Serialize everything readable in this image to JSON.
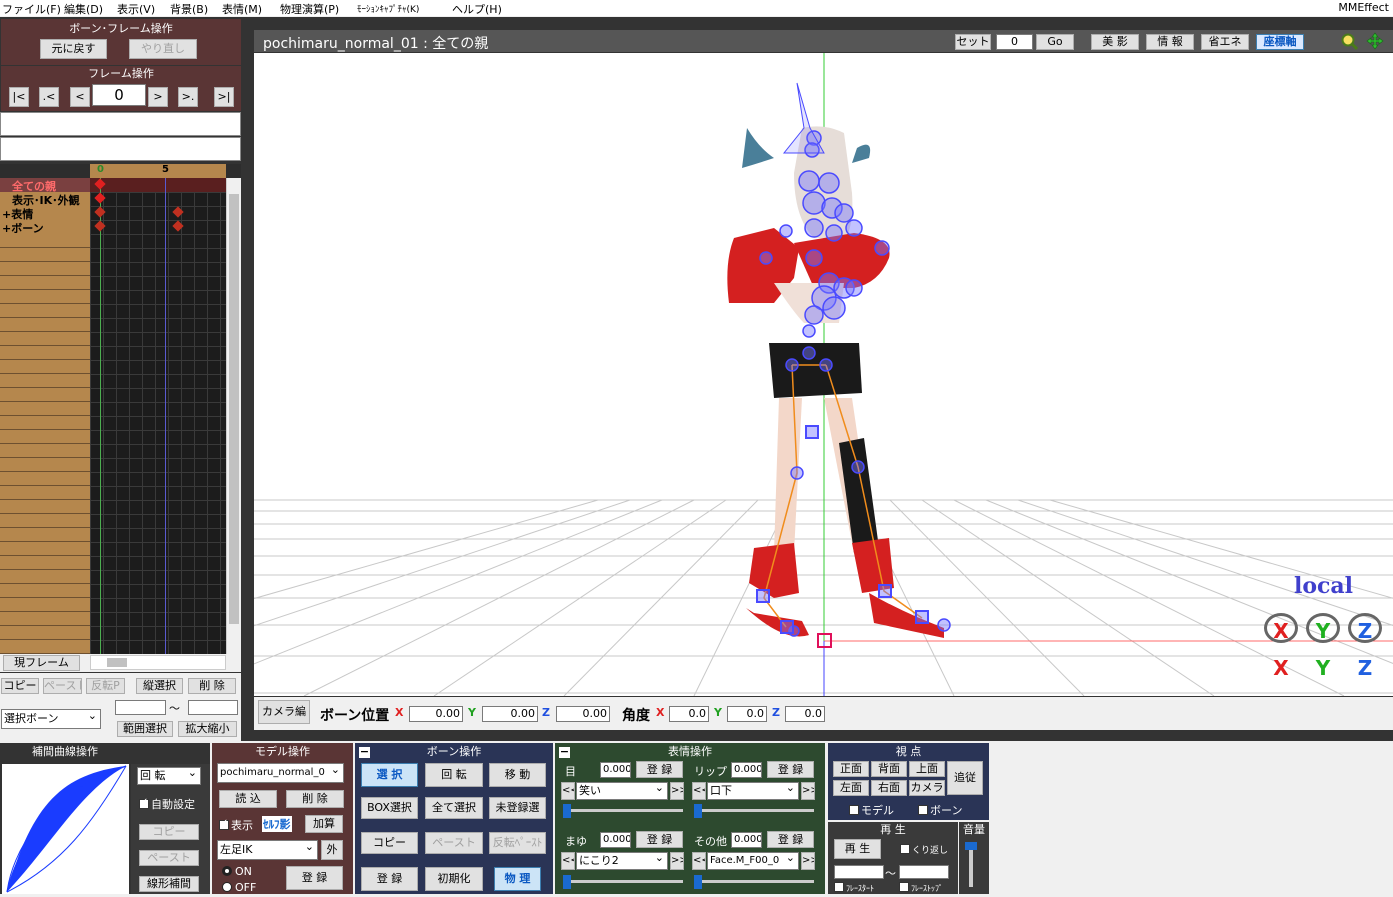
{
  "menu": {
    "items": [
      "ファイル(F)",
      "編集(D)",
      "表示(V)",
      "背景(B)",
      "表情(M)",
      "物理演算(P)",
      "ﾓｰｼｮﾝｷｬﾌﾟﾁｬ(K)",
      "ヘルプ(H)"
    ],
    "right": "MMEffect"
  },
  "bone_frame": {
    "title": "ボーン･フレーム操作",
    "undo": "元に戻す",
    "redo": "やり直し"
  },
  "frame_ops": {
    "title": "フレーム操作",
    "frame_value": "0",
    "nav": [
      "|<",
      ".<",
      "<",
      ">",
      ">.",
      ">|"
    ]
  },
  "timeline": {
    "ruler": [
      "0",
      "5"
    ],
    "rows": [
      "全ての親",
      "表示･IK･外観",
      "+表情",
      "+ボーン"
    ],
    "current_frame_btn": "現フレーム"
  },
  "tl_actions": {
    "copy": "コピー",
    "paste": "ペースト",
    "reverse": "反転P",
    "vsel": "縦選択",
    "del": "削 除",
    "sel_bone": "選択ボーン",
    "range_from": "",
    "tilde": "〜",
    "range_to": "",
    "range_sel": "範囲選択",
    "zoom": "拡大縮小"
  },
  "viewport": {
    "title": "pochimaru_normal_01 : 全ての親",
    "set_label": "セット",
    "set_value": "0",
    "go": "Go",
    "btns": [
      "美 影",
      "情 報",
      "省エネ",
      "座標軸"
    ],
    "local": "local",
    "axes": [
      "X",
      "Y",
      "Z"
    ]
  },
  "bone_pos": {
    "camera_btn": "カメラ編",
    "pos_label": "ボーン位置",
    "px": "0.00",
    "py": "0.00",
    "pz": "0.00",
    "angle_label": "角度",
    "ax": "0.0",
    "ay": "0.0",
    "az": "0.0",
    "x": "X",
    "y": "Y",
    "z": "Z"
  },
  "interp": {
    "title": "補間曲線操作",
    "rotate": "回 転",
    "auto": "自動設定",
    "copy": "コピー",
    "paste": "ペースト",
    "linear": "線形補間"
  },
  "model": {
    "title": "モデル操作",
    "model_name": "pochimaru_normal_0",
    "load": "読 込",
    "del": "削 除",
    "show": "表示",
    "self_shadow": "ｾﾙﾌ影",
    "add": "加算",
    "ik": "左足IK",
    "outer": "外",
    "on": "ON",
    "off": "OFF",
    "register": "登 録"
  },
  "bone_ops": {
    "title": "ボーン操作",
    "select": "選 択",
    "rotate": "回 転",
    "move": "移 動",
    "box": "BOX選択",
    "select_all": "全て選択",
    "unreg": "未登録選",
    "copy": "コピー",
    "paste": "ペースト",
    "rev_paste": "反転ﾍﾟｰｽﾄ",
    "register": "登 録",
    "init": "初期化",
    "physics": "物 理"
  },
  "face": {
    "title": "表情操作",
    "eye": "目",
    "eye_val": "0.000",
    "eye_sel": "笑い",
    "lip": "リップ",
    "lip_val": "0.000",
    "lip_sel": "口下",
    "brow": "まゆ",
    "brow_val": "0.000",
    "brow_sel": "にこり2",
    "other": "その他",
    "other_val": "0.000",
    "other_sel": "Face.M_F00_0",
    "register": "登 録"
  },
  "view": {
    "title": "視 点",
    "front": "正面",
    "back": "背面",
    "top": "上面",
    "left": "左面",
    "right": "右面",
    "camera": "カメラ",
    "follow": "追従",
    "model": "モデル",
    "bone": "ボーン"
  },
  "play": {
    "title": "再 生",
    "play": "再 生",
    "repeat": "くり返し",
    "start": "ﾌﾚｰｽﾀｰﾄ",
    "stop": "ﾌﾚｰｽﾄｯﾌﾟ"
  },
  "volume": {
    "title": "音量"
  },
  "colors": {
    "dark_red": "#5a3535",
    "dark_blue": "#2a3456",
    "dark_green": "#2d4a2f",
    "title_bar": "#565656"
  }
}
